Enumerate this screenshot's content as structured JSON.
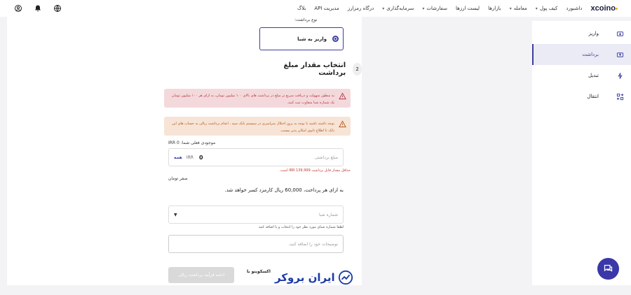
{
  "nav": {
    "logo": "xcoino",
    "menu": [
      {
        "label": "داشبورد",
        "chevron": false
      },
      {
        "label": "کیف پول",
        "chevron": true
      },
      {
        "label": "معامله",
        "chevron": true
      },
      {
        "label": "بازارها",
        "chevron": false
      },
      {
        "label": "لیست ارزها",
        "chevron": false
      },
      {
        "label": "سفارشات",
        "chevron": true
      },
      {
        "label": "سرمایه‌گذاری",
        "chevron": true
      },
      {
        "label": "درگاه رمزارز",
        "chevron": false
      },
      {
        "label": "مدیریت API",
        "chevron": false
      },
      {
        "label": "بلاگ",
        "chevron": false
      }
    ],
    "icons": [
      "globe-icon",
      "bell-icon",
      "user-icon"
    ]
  },
  "sidebar": {
    "items": [
      {
        "label": "واریز",
        "icon": "deposit-icon",
        "active": false
      },
      {
        "label": "برداشت",
        "icon": "withdraw-icon",
        "active": true
      },
      {
        "label": "تبدیل",
        "icon": "convert-icon",
        "active": false
      },
      {
        "label": "انتقال",
        "icon": "transfer-icon",
        "active": false
      }
    ]
  },
  "withdraw": {
    "method_label": "نوع برداشت:",
    "method_option": "واریز به شبا",
    "step_number": "2",
    "step_title": "انتخاب مقدار مبلغ برداشت",
    "alert_red": "به منظور سهولت و دریافت سریع تر مبلغ در برداشت های بالای ۱۰۰ میلیون تومان، به ازای هر ۱۰۰ میلیون تومان یک شماره شبا متفاوت ثبت کنید.",
    "alert_orange": "توجه داشته باشید با توجه به بروز اختلال سراسری در سیستم بانک سپه ، انجام برداشت ریالی به حساب های این بانک تا اطلاع ثانوی امکان پذیر نیست.",
    "balance_label": "موجودی فعلی شما: IRR 0",
    "amount_placeholder": "مبلغ برداشتی",
    "amount_value": "0",
    "currency": "IRR",
    "all_label": "همه",
    "min_note": "حداقل مقدار قابل برداشت IRR 139,999 است.",
    "toman_label": "صفر تومان",
    "fee_note": "به ازای هر پرداخت، 60,000 ریال کارمزد کسر خواهد شد.",
    "sheba_placeholder": "شماره شبا",
    "sheba_hint": "لطفا شماره شبای مورد نظر خود را انتخاب و یا اضافه کنید",
    "desc_placeholder": "توضیحات خود را اضافه کنید.",
    "submit_label": "ادامه فرآیند برداشت ریالی",
    "with_label": "اکسکوینو با",
    "brand_name": "ایران بروکر"
  },
  "colors": {
    "primary": "#3d3d9e",
    "fab": "#3a37a8",
    "alert_red_bg": "#f4d9dc",
    "alert_orange_bg": "#f7e4d6"
  }
}
